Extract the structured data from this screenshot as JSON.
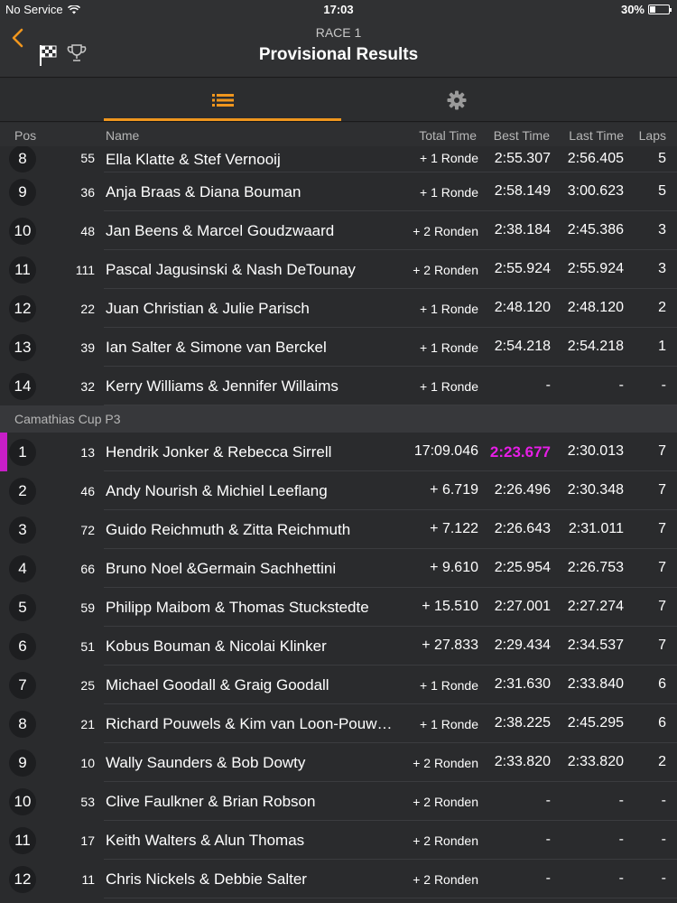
{
  "status_bar": {
    "carrier": "No Service",
    "time": "17:03",
    "battery": "30%",
    "battery_level": 0.3
  },
  "nav": {
    "subtitle": "RACE 1",
    "title": "Provisional Results"
  },
  "columns": {
    "pos": "Pos",
    "name": "Name",
    "total": "Total Time",
    "best": "Best Time",
    "last": "Last Time",
    "laps": "Laps"
  },
  "group1": [
    {
      "pos": "8",
      "num": "55",
      "name": "Ella Klatte & Stef Vernooij",
      "total": "+ 1 Ronde",
      "best": "2:55.307",
      "last": "2:56.405",
      "laps": "5"
    },
    {
      "pos": "9",
      "num": "36",
      "name": "Anja Braas & Diana Bouman",
      "total": "+ 1 Ronde",
      "best": "2:58.149",
      "last": "3:00.623",
      "laps": "5"
    },
    {
      "pos": "10",
      "num": "48",
      "name": "Jan Beens & Marcel Goudzwaard",
      "total": "+ 2 Ronden",
      "best": "2:38.184",
      "last": "2:45.386",
      "laps": "3"
    },
    {
      "pos": "11",
      "num": "111",
      "name": "Pascal Jagusinski & Nash DeTounay",
      "total": "+ 2 Ronden",
      "best": "2:55.924",
      "last": "2:55.924",
      "laps": "3"
    },
    {
      "pos": "12",
      "num": "22",
      "name": "Juan Christian & Julie Parisch",
      "total": "+ 1 Ronde",
      "best": "2:48.120",
      "last": "2:48.120",
      "laps": "2"
    },
    {
      "pos": "13",
      "num": "39",
      "name": "Ian Salter & Simone van Berckel",
      "total": "+ 1 Ronde",
      "best": "2:54.218",
      "last": "2:54.218",
      "laps": "1"
    },
    {
      "pos": "14",
      "num": "32",
      "name": "Kerry Williams & Jennifer Willaims",
      "total": "+ 1 Ronde",
      "best": "-",
      "last": "-",
      "laps": "-"
    }
  ],
  "section_label": "Camathias Cup P3",
  "group2": [
    {
      "pos": "1",
      "num": "13",
      "name": "Hendrik Jonker & Rebecca Sirrell",
      "total": "17:09.046",
      "best": "2:23.677",
      "last": "2:30.013",
      "laps": "7"
    },
    {
      "pos": "2",
      "num": "46",
      "name": "Andy Nourish & Michiel Leeflang",
      "total": "+ 6.719",
      "best": "2:26.496",
      "last": "2:30.348",
      "laps": "7"
    },
    {
      "pos": "3",
      "num": "72",
      "name": "Guido Reichmuth & Zitta Reichmuth",
      "total": "+ 7.122",
      "best": "2:26.643",
      "last": "2:31.011",
      "laps": "7"
    },
    {
      "pos": "4",
      "num": "66",
      "name": "Bruno Noel &Germain Sachhettini",
      "total": "+ 9.610",
      "best": "2:25.954",
      "last": "2:26.753",
      "laps": "7"
    },
    {
      "pos": "5",
      "num": "59",
      "name": "Philipp Maibom & Thomas Stuckstedte",
      "total": "+ 15.510",
      "best": "2:27.001",
      "last": "2:27.274",
      "laps": "7"
    },
    {
      "pos": "6",
      "num": "51",
      "name": "Kobus Bouman & Nicolai Klinker",
      "total": "+ 27.833",
      "best": "2:29.434",
      "last": "2:34.537",
      "laps": "7"
    },
    {
      "pos": "7",
      "num": "25",
      "name": "Michael Goodall & Graig Goodall",
      "total": "+ 1 Ronde",
      "best": "2:31.630",
      "last": "2:33.840",
      "laps": "6"
    },
    {
      "pos": "8",
      "num": "21",
      "name": "Richard Pouwels & Kim van Loon-Pouw…",
      "total": "+ 1 Ronde",
      "best": "2:38.225",
      "last": "2:45.295",
      "laps": "6"
    },
    {
      "pos": "9",
      "num": "10",
      "name": "Wally Saunders & Bob Dowty",
      "total": "+ 2 Ronden",
      "best": "2:33.820",
      "last": "2:33.820",
      "laps": "2"
    },
    {
      "pos": "10",
      "num": "53",
      "name": "Clive Faulkner & Brian Robson",
      "total": "+ 2 Ronden",
      "best": "-",
      "last": "-",
      "laps": "-"
    },
    {
      "pos": "11",
      "num": "17",
      "name": "Keith Walters & Alun Thomas",
      "total": "+ 2 Ronden",
      "best": "-",
      "last": "-",
      "laps": "-"
    },
    {
      "pos": "12",
      "num": "11",
      "name": "Chris Nickels & Debbie Salter",
      "total": "+ 2 Ronden",
      "best": "-",
      "last": "-",
      "laps": "-"
    }
  ],
  "colors": {
    "accent": "#f0961e",
    "fastest": "#e61ee6",
    "leader_marker": "#c81ec8"
  },
  "icons": {
    "back": "chevron-left-icon",
    "flag": "checkered-flag-icon",
    "trophy": "trophy-icon",
    "list": "list-icon",
    "settings": "gear-icon",
    "wifi": "wifi-icon",
    "battery": "battery-icon"
  }
}
